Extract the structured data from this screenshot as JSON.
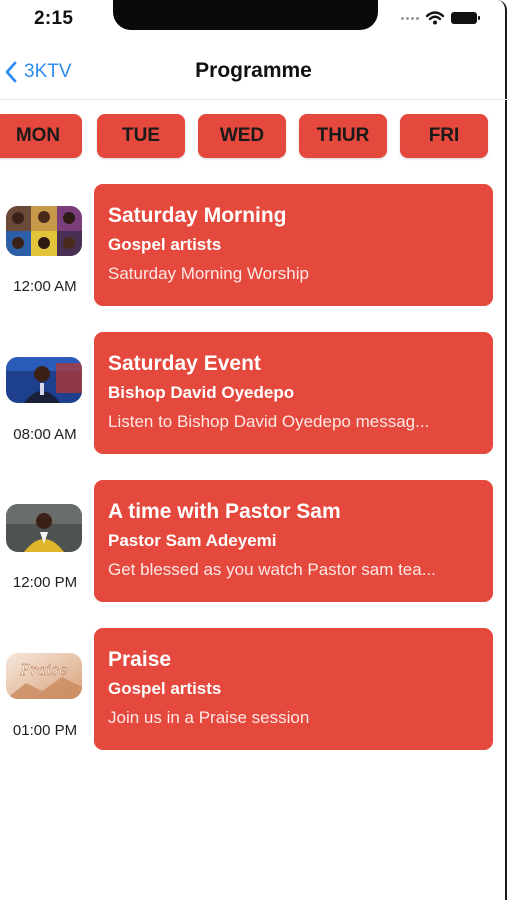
{
  "status_bar": {
    "time": "2:15",
    "icons": [
      "cellular-dots-icon",
      "wifi-icon",
      "battery-icon"
    ]
  },
  "nav": {
    "back_label": "3KTV",
    "back_icon": "chevron-left-icon",
    "title": "Programme"
  },
  "days": [
    "MON",
    "TUE",
    "WED",
    "THUR",
    "FRI"
  ],
  "programmes": [
    {
      "time": "12:00 AM",
      "title": "Saturday Morning",
      "subtitle": "Gospel artists",
      "description": "Saturday Morning Worship",
      "thumbnail": "gospel-artists-collage-image"
    },
    {
      "time": "08:00 AM",
      "title": "Saturday Event",
      "subtitle": "Bishop David Oyedepo",
      "description": "Listen to Bishop David Oyedepo messag...",
      "thumbnail": "bishop-portrait-image"
    },
    {
      "time": "12:00 PM",
      "title": "A time with Pastor Sam",
      "subtitle": "Pastor Sam Adeyemi",
      "description": "Get blessed as you watch Pastor sam tea...",
      "thumbnail": "pastor-portrait-image"
    },
    {
      "time": "01:00 PM",
      "title": "Praise",
      "subtitle": "Gospel artists",
      "description": "Join us in a Praise session",
      "thumbnail": "praise-graphic-image",
      "thumbnail_text": "Praise"
    }
  ],
  "colors": {
    "accent": "#e5483d",
    "link": "#2f8cf0",
    "background": "#ffffff"
  }
}
